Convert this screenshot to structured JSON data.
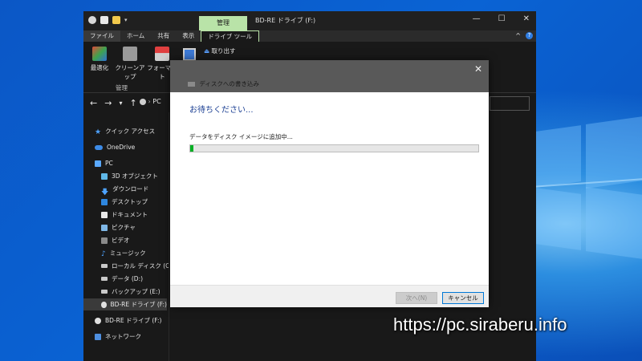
{
  "explorer": {
    "window_title": "BD-RE ドライブ (F:)",
    "context_tab": "管理",
    "window_buttons": {
      "minimize": "—",
      "maximize": "☐",
      "close": "✕"
    },
    "tabs": [
      "ファイル",
      "ホーム",
      "共有",
      "表示",
      "ドライブ ツール"
    ],
    "ribbon": {
      "buttons": [
        "最適化",
        "クリーンアップ",
        "フォーマット"
      ],
      "group_label": "管理",
      "eject_label": "取り出す",
      "collapse_chevron": "^",
      "help": "?"
    },
    "nav": {
      "back": "←",
      "forward": "→",
      "dropdown": "▾",
      "up": "↑"
    },
    "address": "PC",
    "sidebar": [
      {
        "label": "クイック アクセス",
        "icon": "star-icon"
      },
      {
        "label": "OneDrive",
        "icon": "cloud-icon"
      },
      {
        "label": "PC",
        "icon": "computer-icon"
      },
      {
        "label": "3D オブジェクト",
        "icon": "cube-icon"
      },
      {
        "label": "ダウンロード",
        "icon": "download-icon"
      },
      {
        "label": "デスクトップ",
        "icon": "desktop-icon"
      },
      {
        "label": "ドキュメント",
        "icon": "document-icon"
      },
      {
        "label": "ピクチャ",
        "icon": "picture-icon"
      },
      {
        "label": "ビデオ",
        "icon": "video-icon"
      },
      {
        "label": "ミュージック",
        "icon": "music-icon"
      },
      {
        "label": "ローカル ディスク (C:)",
        "icon": "drive-icon"
      },
      {
        "label": "データ (D:)",
        "icon": "drive-icon"
      },
      {
        "label": "バックアップ (E:)",
        "icon": "drive-icon"
      },
      {
        "label": "BD-RE ドライブ (F:)",
        "icon": "disc-icon"
      },
      {
        "label": "BD-RE ドライブ (F:)",
        "icon": "disc-icon"
      },
      {
        "label": "ネットワーク",
        "icon": "network-icon"
      }
    ]
  },
  "dialog": {
    "title": "ディスクへの書き込み",
    "close": "✕",
    "heading": "お待ちください...",
    "status": "データをディスク イメージに追加中...",
    "progress": 0.01,
    "next_label": "次へ(N)",
    "cancel_label": "キャンセル"
  },
  "watermark": "https://pc.siraberu.info",
  "colors": {
    "accent": "#0078d7",
    "progress": "#06b025",
    "context_tab": "#b9e3a8",
    "heading": "#1b3f93"
  }
}
